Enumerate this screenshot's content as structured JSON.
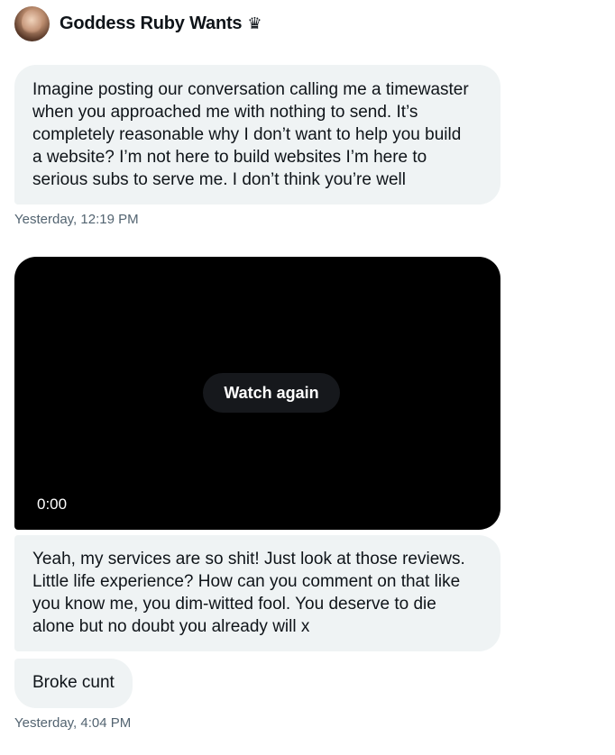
{
  "header": {
    "name": "Goddess Ruby Wants",
    "name_glyph": "♛",
    "avatar_icon": "profile-photo"
  },
  "messages": [
    {
      "type": "text",
      "text": "Imagine posting our conversation calling me a timewaster when you approached me with nothing to send. It’s completely reasonable why I don’t want to help you build a website? I’m not here to build websites I’m here to serious subs to serve me. I don’t think you’re well",
      "lines": [
        "Imagine posting our conversation calling me a timewaster",
        "when you approached me with nothing to send. It’s",
        "completely reasonable why I don’t want to help you build",
        "a website? I’m not here to build websites I’m here to",
        "serious subs to serve me. I don’t think you’re well"
      ],
      "timestamp": "Yesterday, 12:19 PM"
    },
    {
      "type": "video",
      "button_label": "Watch again",
      "time_label": "0:00"
    },
    {
      "type": "text",
      "lines": [
        "Yeah, my services are so shit! Just look at those reviews.",
        "Little life experience? How can you comment on that like",
        "you know me, you dim-witted fool. You deserve to die",
        "alone but no doubt you already will x"
      ]
    },
    {
      "type": "text",
      "text": "Broke cunt",
      "timestamp": "Yesterday, 4:04 PM"
    }
  ],
  "colors": {
    "bubble_bg": "#eff3f4",
    "text": "#0f1419",
    "timestamp": "#536471",
    "video_bg": "#000000",
    "button_bg": "#16181c"
  }
}
